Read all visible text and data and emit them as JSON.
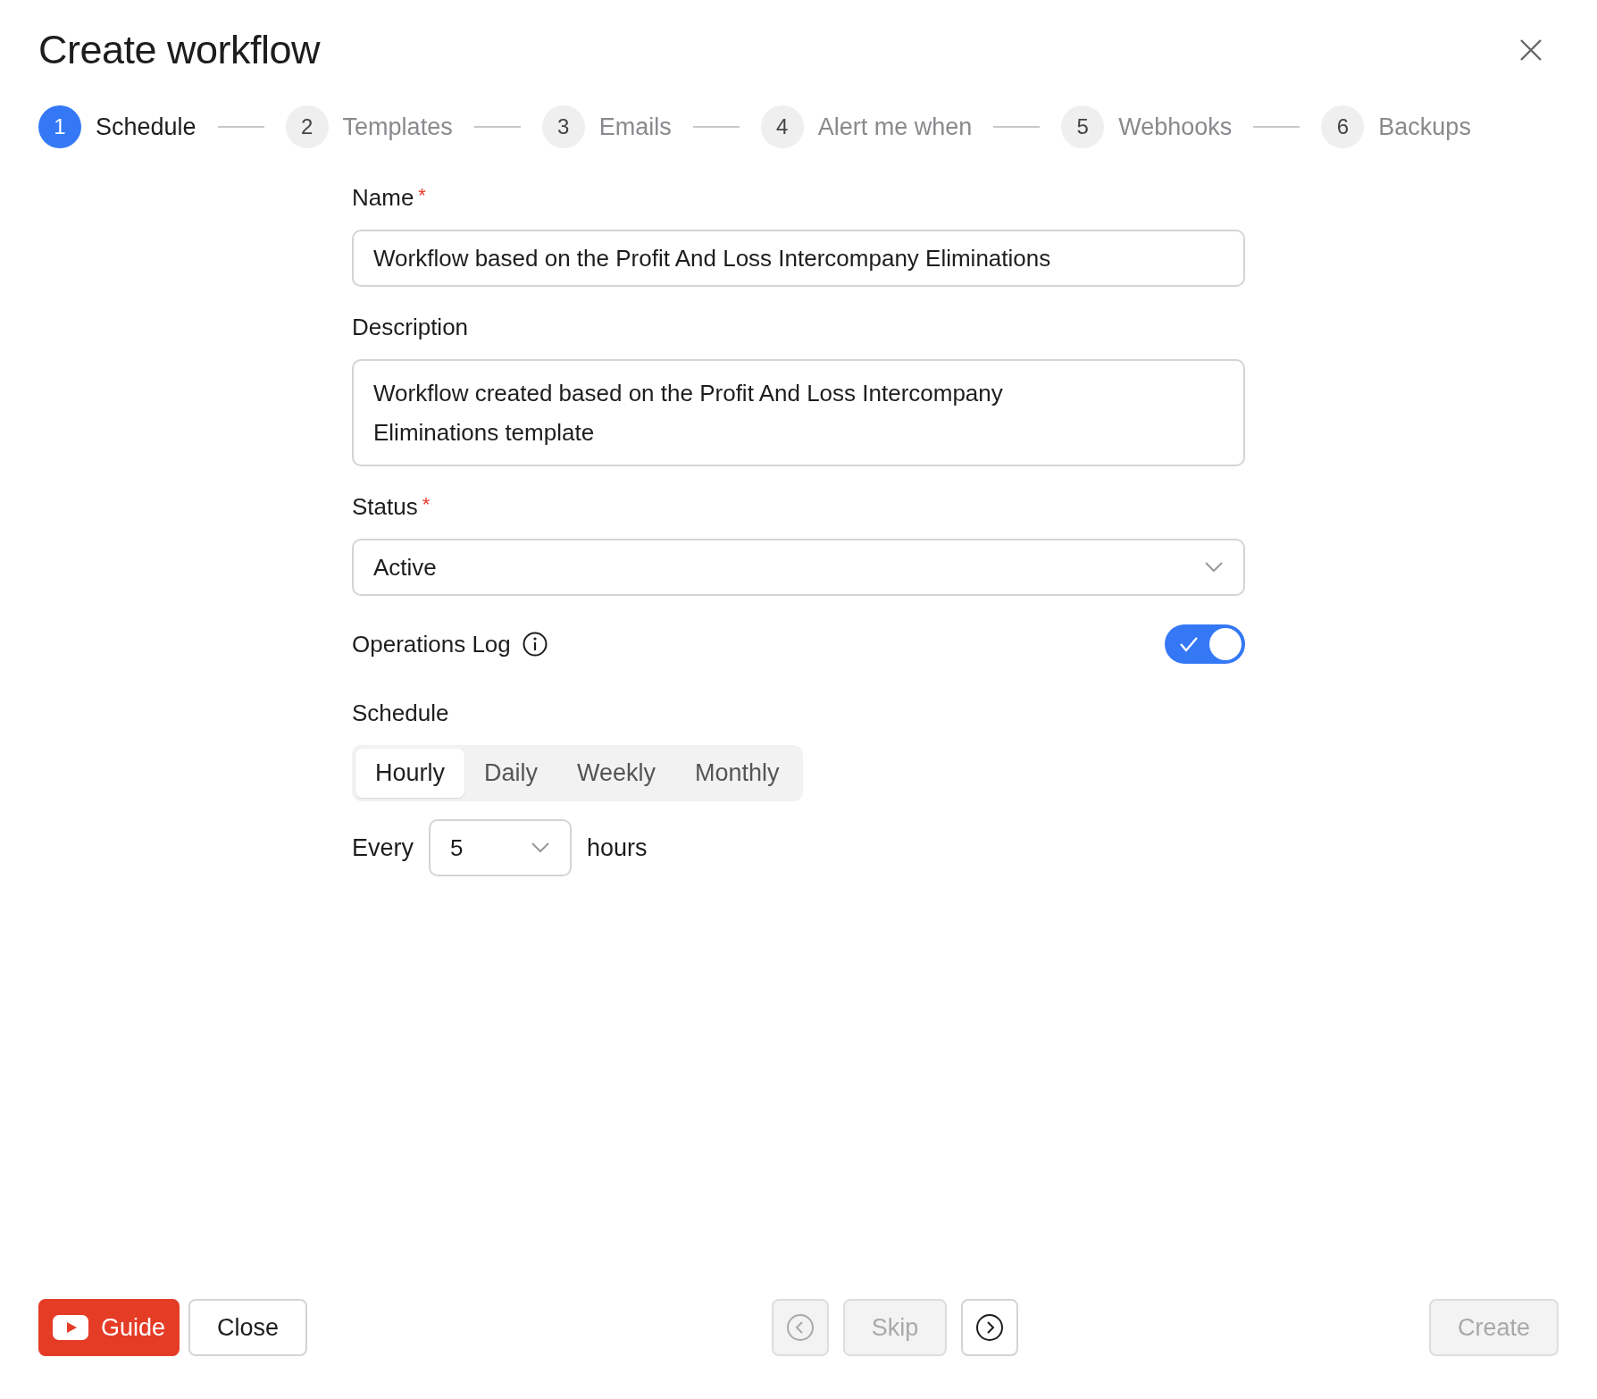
{
  "dialog": {
    "title": "Create workflow"
  },
  "steps": [
    {
      "number": "1",
      "label": "Schedule",
      "selected": true
    },
    {
      "number": "2",
      "label": "Templates",
      "selected": false
    },
    {
      "number": "3",
      "label": "Emails",
      "selected": false
    },
    {
      "number": "4",
      "label": "Alert me when",
      "selected": false
    },
    {
      "number": "5",
      "label": "Webhooks",
      "selected": false
    },
    {
      "number": "6",
      "label": "Backups",
      "selected": false
    }
  ],
  "form": {
    "name": {
      "label": "Name",
      "required_mark": "*",
      "value": "Workflow based on the Profit And Loss Intercompany Eliminations"
    },
    "description": {
      "label": "Description",
      "value": "Workflow created based on the Profit And Loss Intercompany Eliminations template"
    },
    "status": {
      "label": "Status",
      "required_mark": "*",
      "value": "Active"
    },
    "operations_log": {
      "label": "Operations Log",
      "on": true
    },
    "schedule": {
      "label": "Schedule",
      "options": [
        {
          "label": "Hourly",
          "selected": true
        },
        {
          "label": "Daily",
          "selected": false
        },
        {
          "label": "Weekly",
          "selected": false
        },
        {
          "label": "Monthly",
          "selected": false
        }
      ]
    },
    "every": {
      "label": "Every",
      "value": "5",
      "unit": "hours"
    }
  },
  "footer": {
    "left": [
      {
        "kind": "guide",
        "label": "Guide"
      },
      {
        "kind": "text",
        "label": "Close",
        "disabled": false
      }
    ],
    "middle": [
      {
        "kind": "back",
        "disabled": true
      },
      {
        "kind": "text",
        "label": "Skip",
        "disabled": true
      },
      {
        "kind": "next",
        "disabled": false
      }
    ],
    "right": [
      {
        "kind": "text",
        "label": "Create",
        "disabled": true
      }
    ]
  }
}
